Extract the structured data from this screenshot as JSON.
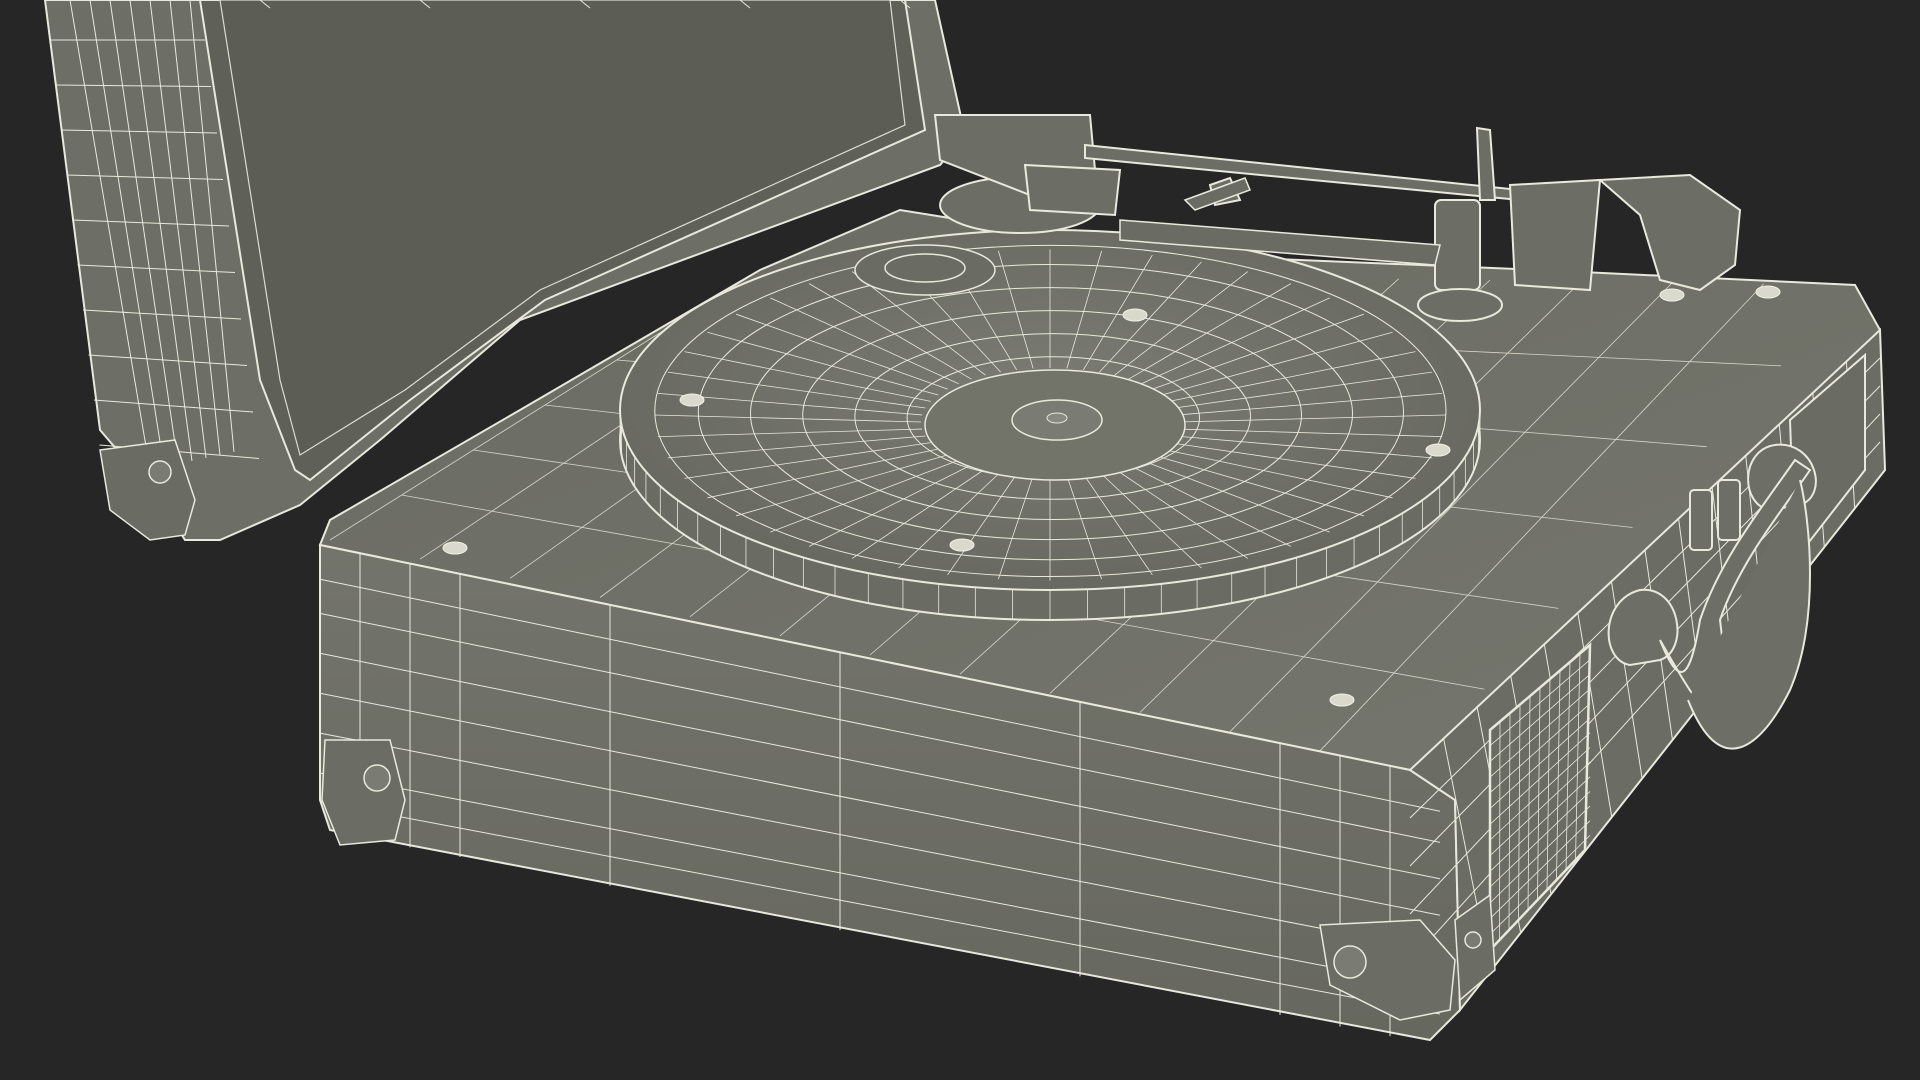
{
  "scene": {
    "subject": "suitcase-record-player-wireframe",
    "colors": {
      "background": "#262626",
      "surface": "#6e6f66",
      "surface_dark": "#5f6058",
      "surface_light": "#7b7c73",
      "lid_inner": "#626359",
      "wire": "#e8e8dc",
      "wire_dim": "#c9c9bd"
    },
    "parts": [
      "lid",
      "base-top",
      "base-front",
      "base-side",
      "platter",
      "tonearm",
      "speaker-grille",
      "handle",
      "corner-caps",
      "screws"
    ]
  }
}
